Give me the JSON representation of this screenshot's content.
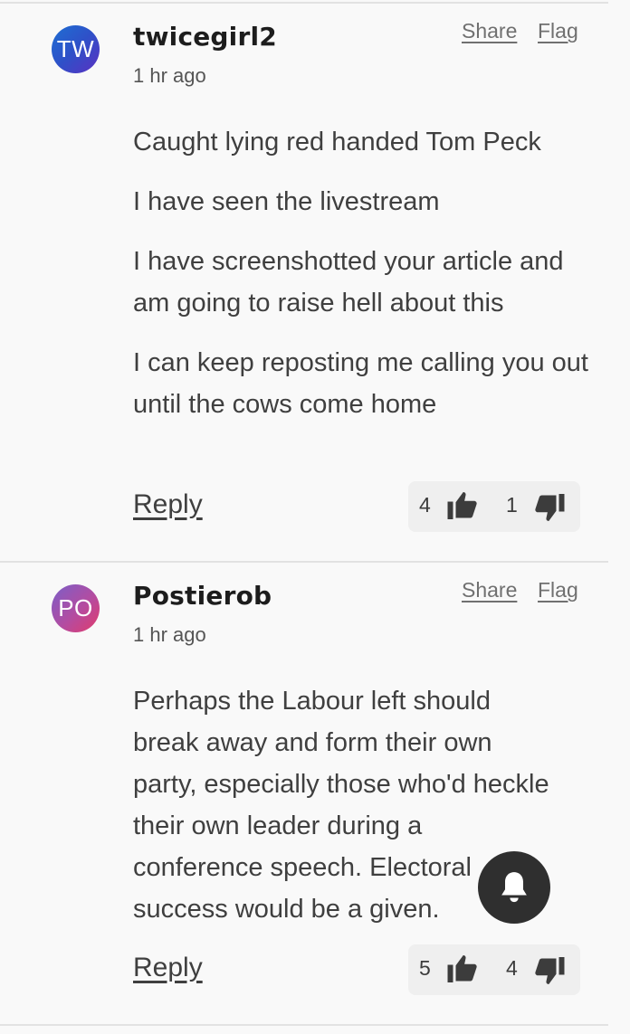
{
  "comments": [
    {
      "avatar_initials": "TW",
      "username": "twicegirl2",
      "timestamp": "1 hr ago",
      "share_label": "Share",
      "flag_label": "Flag",
      "paragraphs": [
        "Caught lying red handed Tom Peck",
        "I have seen the livestream",
        "I have screenshotted your article and am going to raise hell about this",
        "I can keep reposting me calling you out until the cows come home"
      ],
      "reply_label": "Reply",
      "upvotes": "4",
      "downvotes": "1"
    },
    {
      "avatar_initials": "PO",
      "username": "Postierob",
      "timestamp": "1 hr ago",
      "share_label": "Share",
      "flag_label": "Flag",
      "paragraphs": [
        "Perhaps the Labour left should break away and form their own party, especially those who'd heckle their own leader during a conference speech. Electoral success would be a given."
      ],
      "reply_label": "Reply",
      "upvotes": "5",
      "downvotes": "4"
    }
  ],
  "icons": {
    "thumbs_up": "thumbs-up-icon",
    "thumbs_down": "thumbs-down-icon",
    "notification": "bell-icon"
  }
}
